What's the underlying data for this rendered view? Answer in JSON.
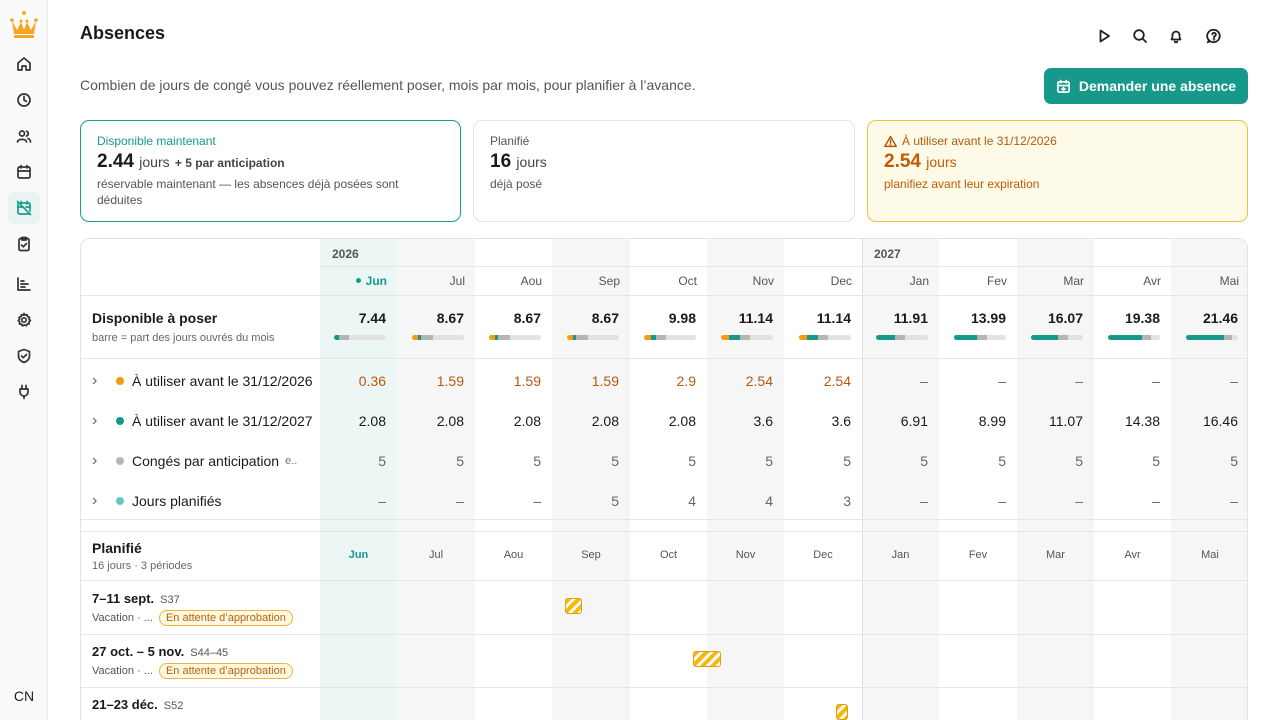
{
  "sidebar": {
    "items": [
      {
        "icon": "home-icon"
      },
      {
        "icon": "clock-icon"
      },
      {
        "icon": "users-icon"
      },
      {
        "icon": "calendar-icon"
      },
      {
        "icon": "calendar-off-icon",
        "active": true
      },
      {
        "icon": "clipboard-check-icon"
      },
      {
        "icon": "bar-chart-icon"
      },
      {
        "icon": "gear-icon"
      },
      {
        "icon": "shield-check-icon"
      },
      {
        "icon": "plug-icon"
      }
    ],
    "avatar": "CN"
  },
  "header": {
    "title": "Absences",
    "subtitle": "Combien de jours de congé vous pouvez réellement poser, mois par mois, pour planifier à l’avance.",
    "cta_label": "Demander une absence"
  },
  "cards": {
    "available": {
      "label": "Disponible maintenant",
      "value": "2.44",
      "unit": "jours",
      "extra": "+ 5 par anticipation",
      "note": "réservable maintenant — les absences déjà posées sont déduites"
    },
    "planned": {
      "label": "Planifié",
      "value": "16",
      "unit": "jours",
      "note": "déjà posé"
    },
    "expiring": {
      "label": "À utiliser avant le 31/12/2026",
      "value": "2.54",
      "unit": "jours",
      "note": "planifiez avant leur expiration"
    }
  },
  "table": {
    "years": [
      "2026",
      "2027"
    ],
    "months": [
      "Jun",
      "Jul",
      "Aou",
      "Sep",
      "Oct",
      "Nov",
      "Dec",
      "Jan",
      "Fev",
      "Mar",
      "Avr",
      "Mai"
    ],
    "available_row": {
      "title": "Disponible à poser",
      "subtitle": "barre = part des jours ouvrés du mois",
      "values": [
        "7.44",
        "8.67",
        "8.67",
        "8.67",
        "9.98",
        "11.14",
        "11.14",
        "11.91",
        "13.99",
        "16.07",
        "19.38",
        "21.46"
      ],
      "bar_fill": [
        [
          0,
          0.1,
          0.18
        ],
        [
          0.12,
          0.06,
          0.22
        ],
        [
          0.12,
          0.06,
          0.22
        ],
        [
          0.12,
          0.06,
          0.22
        ],
        [
          0.14,
          0.09,
          0.2
        ],
        [
          0.16,
          0.2,
          0.2
        ],
        [
          0.16,
          0.2,
          0.2
        ],
        [
          0,
          0.36,
          0.2
        ],
        [
          0,
          0.44,
          0.2
        ],
        [
          0,
          0.52,
          0.2
        ],
        [
          0,
          0.66,
          0.16
        ],
        [
          0,
          0.74,
          0.14
        ]
      ],
      "bar_colors": {
        "orange": "#f39c12",
        "teal": "#16998a",
        "grey": "#b5b5b5"
      }
    },
    "rows": [
      {
        "label": "À utiliser avant le 31/12/2026",
        "dot": "#f39c12",
        "style": "orange",
        "values": [
          "0.36",
          "1.59",
          "1.59",
          "1.59",
          "2.9",
          "2.54",
          "2.54",
          "–",
          "–",
          "–",
          "–",
          "–"
        ]
      },
      {
        "label": "À utiliser avant le 31/12/2027",
        "dot": "#16998a",
        "style": "normal",
        "values": [
          "2.08",
          "2.08",
          "2.08",
          "2.08",
          "2.08",
          "3.6",
          "3.6",
          "6.91",
          "8.99",
          "11.07",
          "14.38",
          "16.46"
        ]
      },
      {
        "label": "Congés par anticipation",
        "dot": "#b5b5b5",
        "style": "muted",
        "trailing": "e..",
        "values": [
          "5",
          "5",
          "5",
          "5",
          "5",
          "5",
          "5",
          "5",
          "5",
          "5",
          "5",
          "5"
        ]
      },
      {
        "label": "Jours planifiés",
        "dot": "#6cc7bb",
        "style": "muted",
        "values": [
          "–",
          "–",
          "–",
          "5",
          "4",
          "4",
          "3",
          "–",
          "–",
          "–",
          "–",
          "–"
        ]
      }
    ],
    "planned": {
      "title": "Planifié",
      "subtitle": "16 jours · 3 périodes",
      "events": [
        {
          "dates": "7–11 sept.",
          "week": "S37",
          "type": "Vacation · ...",
          "status": "En attente d’approbation"
        },
        {
          "dates": "27 oct. – 5 nov.",
          "week": "S44–45",
          "type": "Vacation · ...",
          "status": "En attente d’approbation"
        },
        {
          "dates": "21–23 déc.",
          "week": "S52",
          "type": "",
          "status": ""
        }
      ]
    }
  }
}
